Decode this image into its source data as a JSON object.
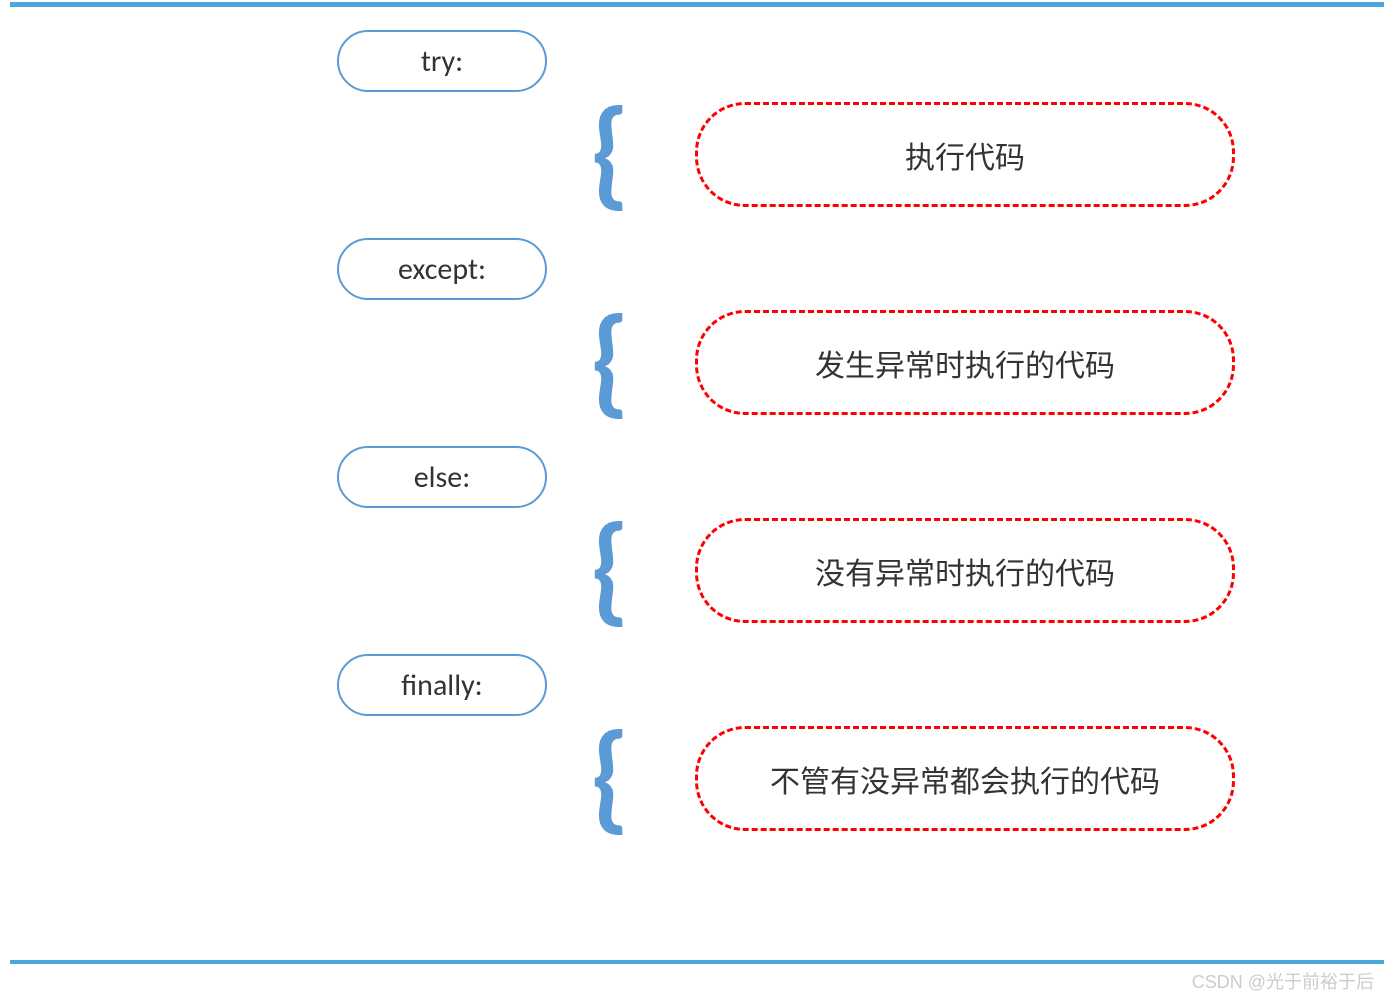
{
  "keywords": {
    "try": "try:",
    "except": "except:",
    "else": "else:",
    "finally": "finally:"
  },
  "descriptions": {
    "try": "执行代码",
    "except": "发生异常时执行的代码",
    "else": "没有异常时执行的代码",
    "finally": "不管有没异常都会执行的代码"
  },
  "watermark": "CSDN @光于前裕于后"
}
